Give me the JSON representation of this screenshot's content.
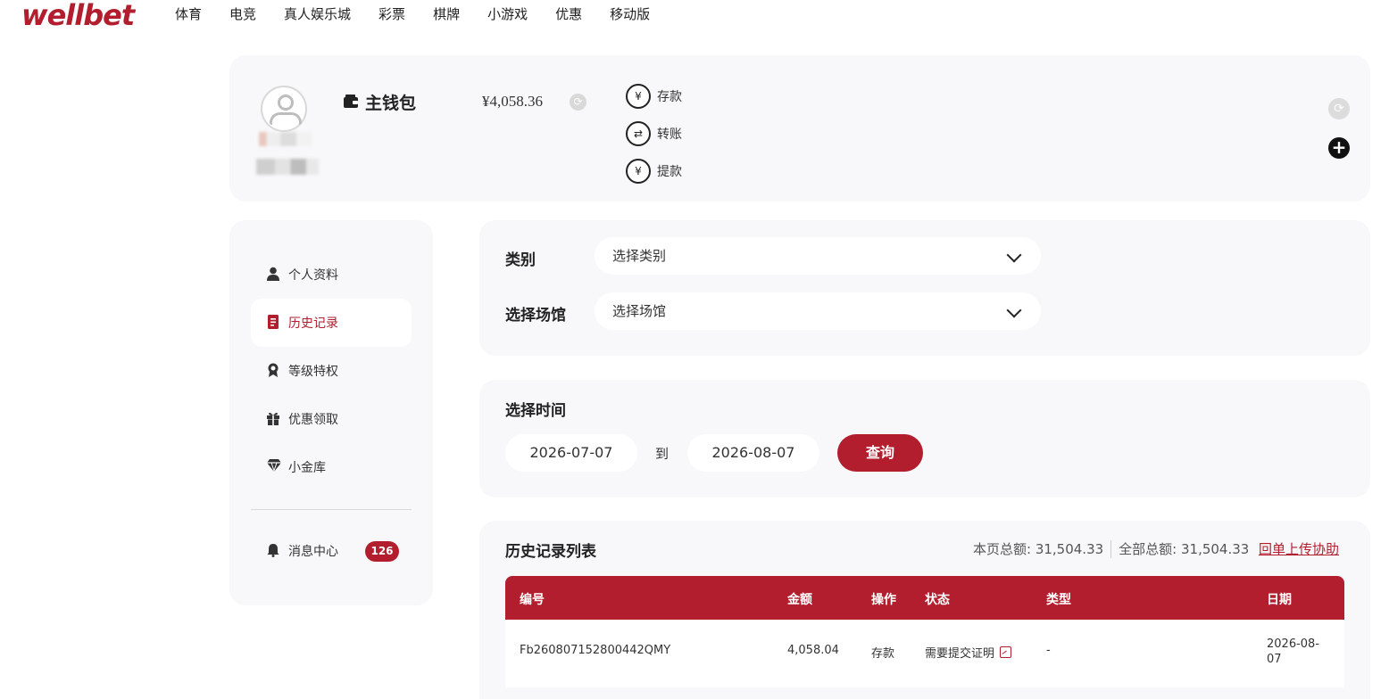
{
  "brand": {
    "logo_text": "wellbet",
    "accent_color": "#b21e2d"
  },
  "nav": {
    "items": [
      "体育",
      "电竞",
      "真人娱乐城",
      "彩票",
      "棋牌",
      "小游戏",
      "优惠",
      "移动版"
    ]
  },
  "wallet": {
    "title": "主钱包",
    "balance": "¥4,058.36",
    "actions": [
      {
        "label": "存款",
        "icon": "deposit-icon"
      },
      {
        "label": "转账",
        "icon": "transfer-icon"
      },
      {
        "label": "提款",
        "icon": "withdraw-icon"
      }
    ]
  },
  "sidebar": {
    "items": [
      {
        "label": "个人资料",
        "icon": "user-icon"
      },
      {
        "label": "历史记录",
        "icon": "history-icon",
        "active": true
      },
      {
        "label": "等级特权",
        "icon": "medal-icon"
      },
      {
        "label": "优惠领取",
        "icon": "gift-icon"
      },
      {
        "label": "小金库",
        "icon": "diamond-icon"
      }
    ],
    "messages": {
      "label": "消息中心",
      "icon": "bell-icon",
      "count": "126"
    }
  },
  "filters": {
    "category_label": "类别",
    "category_placeholder": "选择类别",
    "venue_label": "选择场馆",
    "venue_placeholder": "选择场馆"
  },
  "time": {
    "label": "选择时间",
    "start": "2026-07-07",
    "to": "到",
    "end": "2026-08-07",
    "query_label": "查询"
  },
  "history": {
    "title": "历史记录列表",
    "page_total": "本页总额: 31,504.33",
    "all_total": "全部总额: 31,504.33",
    "upload_link": "回单上传协助",
    "columns": [
      "编号",
      "金额",
      "操作",
      "状态",
      "类型",
      "日期"
    ],
    "rows": [
      {
        "id": "Fb260807152800442QMY",
        "amount": "4,058.04",
        "action": "存款",
        "status": "需要提交证明",
        "type": "-",
        "date_line1": "2026-08-",
        "date_line2": "07"
      }
    ]
  }
}
